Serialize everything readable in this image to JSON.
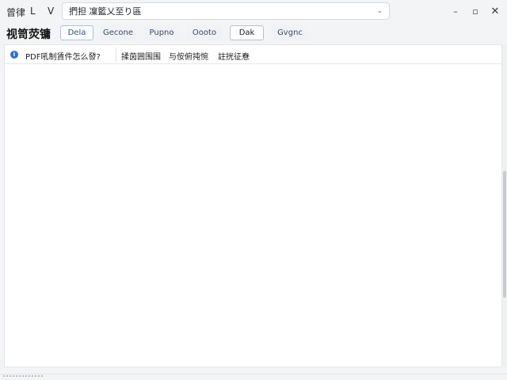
{
  "titlebar": {
    "menu": [
      "曾律",
      "L",
      "V"
    ],
    "search": {
      "value": "捫担 凜籃乂至り區",
      "chevron": "⌄"
    },
    "window_buttons": {
      "minimize": "–",
      "maximize": "▫",
      "close": "✕"
    }
  },
  "toolbar": {
    "title": "视笥荧镛",
    "chips": [
      "Dela",
      "Gecone",
      "Pupno",
      "Oooto",
      "Dak",
      "Gvgnc"
    ]
  },
  "notice": {
    "icon": "info-icon",
    "question": "PDF吼制賃件怎么發?",
    "links": [
      "揉茵囲围围",
      "与侒俯扽惋",
      "註挄征憃"
    ]
  },
  "colors": {
    "accent": "#2f6fd6",
    "background": "#f3f4f6",
    "panel": "#ffffff"
  }
}
